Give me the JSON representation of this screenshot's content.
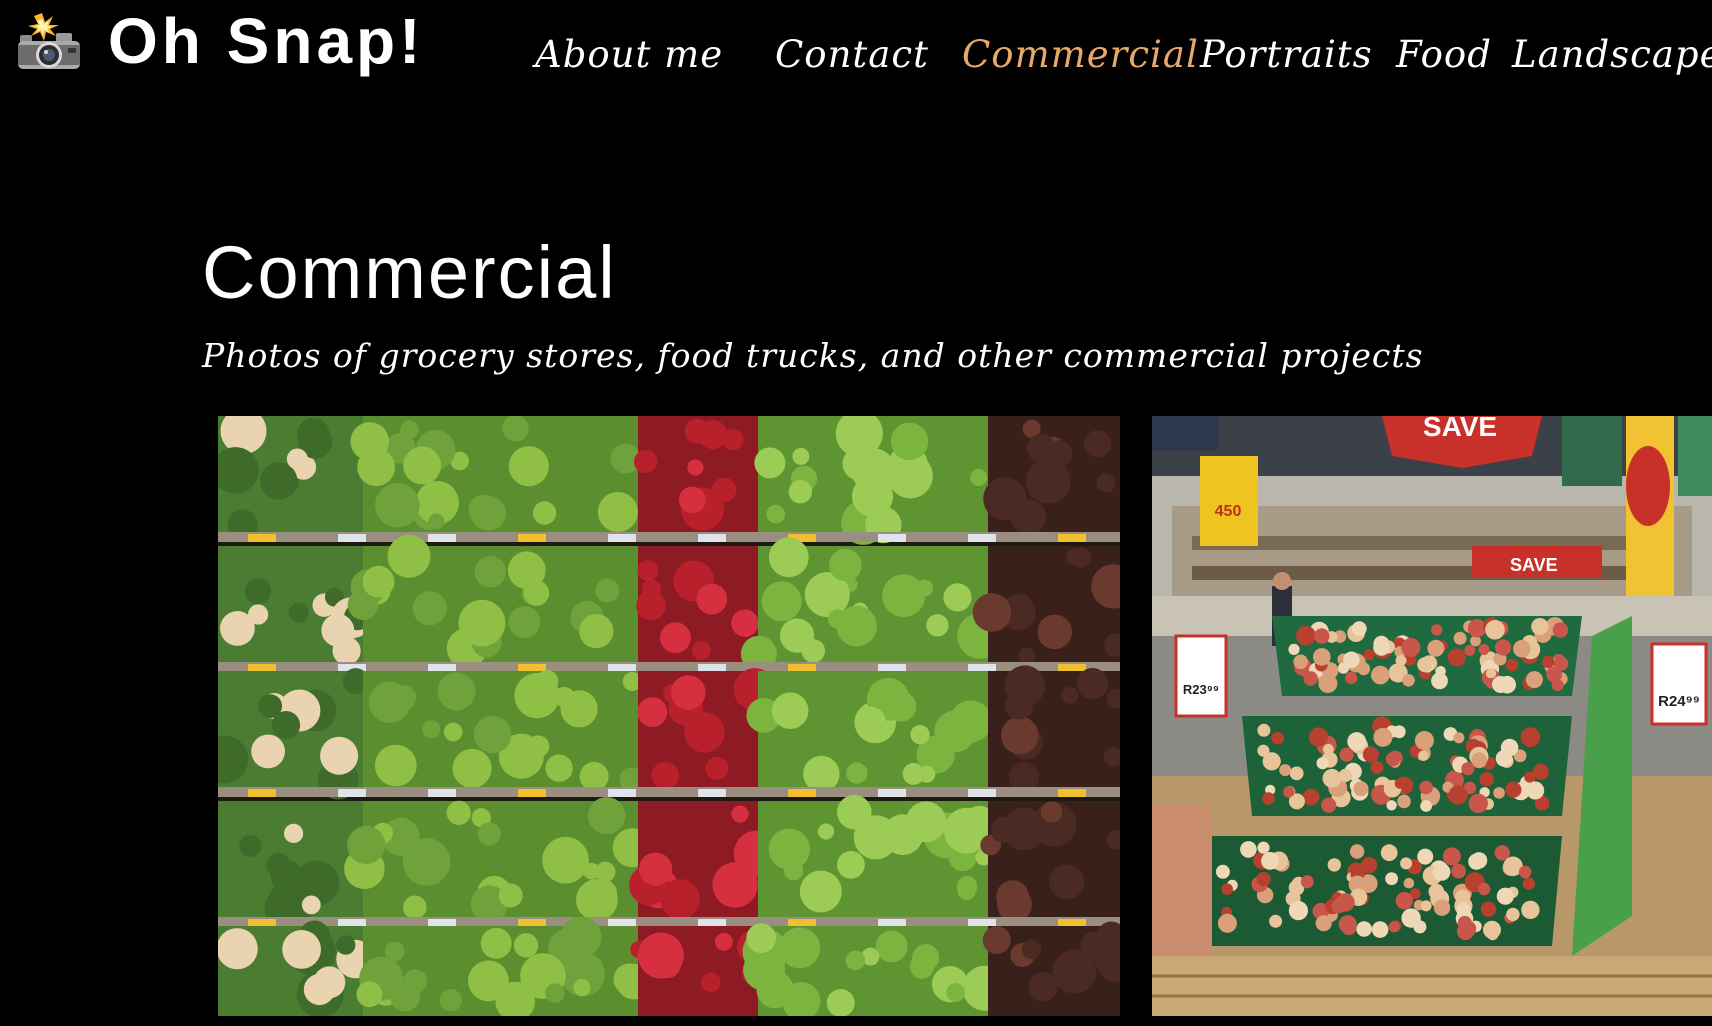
{
  "site": {
    "title": "Oh Snap!",
    "logo_icon": "camera-flash-icon"
  },
  "nav": {
    "items": [
      {
        "label": "About me",
        "active": false
      },
      {
        "label": "Contact",
        "active": false
      },
      {
        "label": "Commercial",
        "active": true
      },
      {
        "label": "Portraits",
        "active": false
      },
      {
        "label": "Food",
        "active": false
      },
      {
        "label": "Landscape",
        "active": false
      }
    ],
    "active_color": "#e8a968"
  },
  "main": {
    "title": "Commercial",
    "subtitle": "Photos of grocery stores, food trucks, and other commercial projects"
  },
  "gallery": {
    "photos": [
      {
        "name": "produce-shelves-photo"
      },
      {
        "name": "fruit-market-photo",
        "signs": {
          "sale": "SAVE",
          "price": "R24⁹⁹",
          "price_small": "R23⁹⁹",
          "promo": "450"
        }
      }
    ]
  },
  "colors": {
    "background": "#000000",
    "text": "#ffffff",
    "accent": "#e8a968"
  }
}
